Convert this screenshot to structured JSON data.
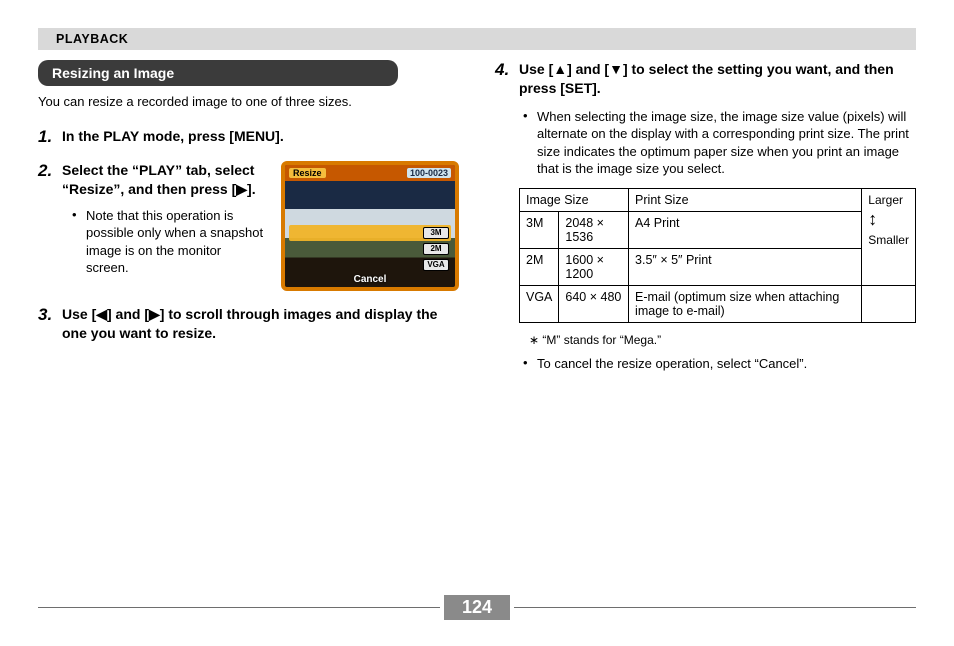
{
  "header": {
    "section": "PLAYBACK"
  },
  "title_bar": "Resizing an Image",
  "intro": "You can resize a recorded image to one of three sizes.",
  "steps": {
    "s1": {
      "num": "1.",
      "text": "In the PLAY mode, press [MENU]."
    },
    "s2": {
      "num": "2.",
      "text": "Select the “PLAY” tab, select “Resize”, and then press [▶].",
      "note": "Note that this operation is possible only when a snapshot image is on the monitor screen."
    },
    "s3": {
      "num": "3.",
      "text": "Use [◀] and [▶] to scroll through images and display the one you want to resize."
    },
    "s4": {
      "num": "4.",
      "text": "Use [▲] and [▼] to select the setting you want, and then press [SET].",
      "note": "When selecting the image size, the image size value (pixels) will alternate on the display with a corresponding print size. The print size indicates the optimum paper size when you print an image that is the image size you select."
    }
  },
  "thumb": {
    "resize_tab": "Resize",
    "counter": "100-0023",
    "pill1": "3M",
    "pill2": "2M",
    "pill3": "VGA",
    "cancel": "Cancel"
  },
  "table": {
    "h_image_size": "Image Size",
    "h_print_size": "Print Size",
    "r1c1": "3M",
    "r1c2": "2048 × 1536",
    "r1c3": "A4 Print",
    "r2c1": "2M",
    "r2c2": "1600 × 1200",
    "r2c3": "3.5″ × 5″ Print",
    "r3c1": "VGA",
    "r3c2": "640 × 480",
    "r3c3": "E-mail (optimum size when attaching image to e-mail)",
    "larger": "Larger",
    "smaller": "Smaller"
  },
  "footnote_star": "∗ “M” stands for “Mega.”",
  "cancel_note": "To cancel the resize operation, select “Cancel”.",
  "page_number": "124"
}
